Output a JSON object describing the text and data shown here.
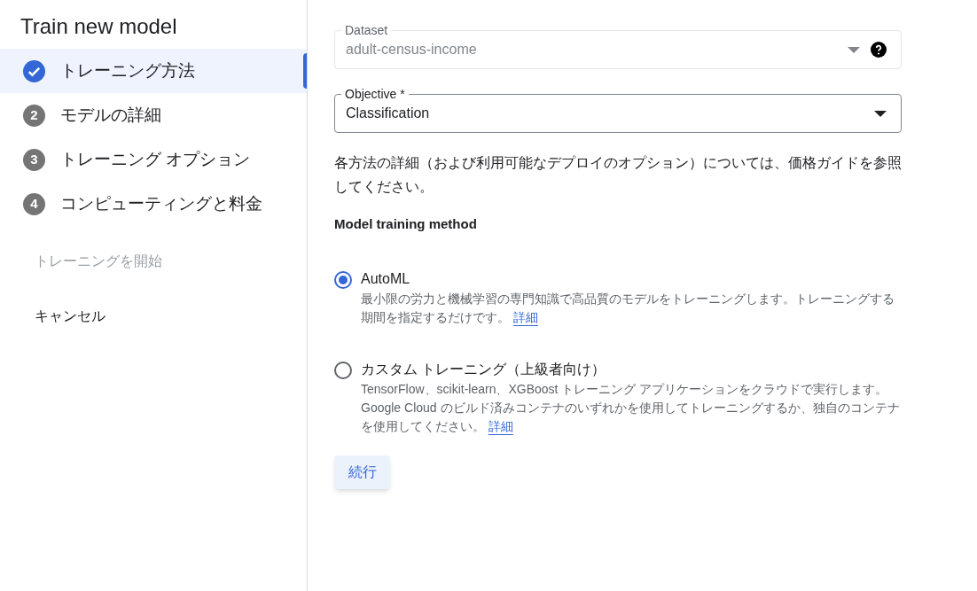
{
  "title": "Train new model",
  "steps": [
    {
      "label": "トレーニング方法",
      "selected": true,
      "completed": true
    },
    {
      "number": "2",
      "label": "モデルの詳細",
      "selected": false,
      "completed": false
    },
    {
      "number": "3",
      "label": "トレーニング オプション",
      "selected": false,
      "completed": false
    },
    {
      "number": "4",
      "label": "コンピューティングと料金",
      "selected": false,
      "completed": false
    }
  ],
  "start_button": {
    "label": "トレーニングを開始",
    "disabled": true
  },
  "cancel_button": {
    "label": "キャンセル",
    "disabled": false
  },
  "dataset": {
    "label": "Dataset",
    "value": "adult-census-income",
    "disabled": true
  },
  "objective": {
    "label": "Objective *",
    "value": "Classification",
    "disabled": false
  },
  "info_text": "各方法の詳細（および利用可能なデプロイのオプション）については、価格ガイドを参照してください。",
  "method_heading": "Model training method",
  "methods": [
    {
      "label": "AutoML",
      "description": "最小限の労力と機械学習の専門知識で高品質のモデルをトレーニングします。トレーニングする期間を指定するだけです。",
      "link": "詳細",
      "selected": true
    },
    {
      "label": "カスタム トレーニング（上級者向け）",
      "description": "TensorFlow、scikit-learn、XGBoost トレーニング アプリケーションをクラウドで実行します。Google Cloud のビルド済みコンテナのいずれかを使用してトレーニングするか、独自のコンテナを使用してください。",
      "link": "詳細",
      "selected": false
    }
  ],
  "continue_button": "続行"
}
